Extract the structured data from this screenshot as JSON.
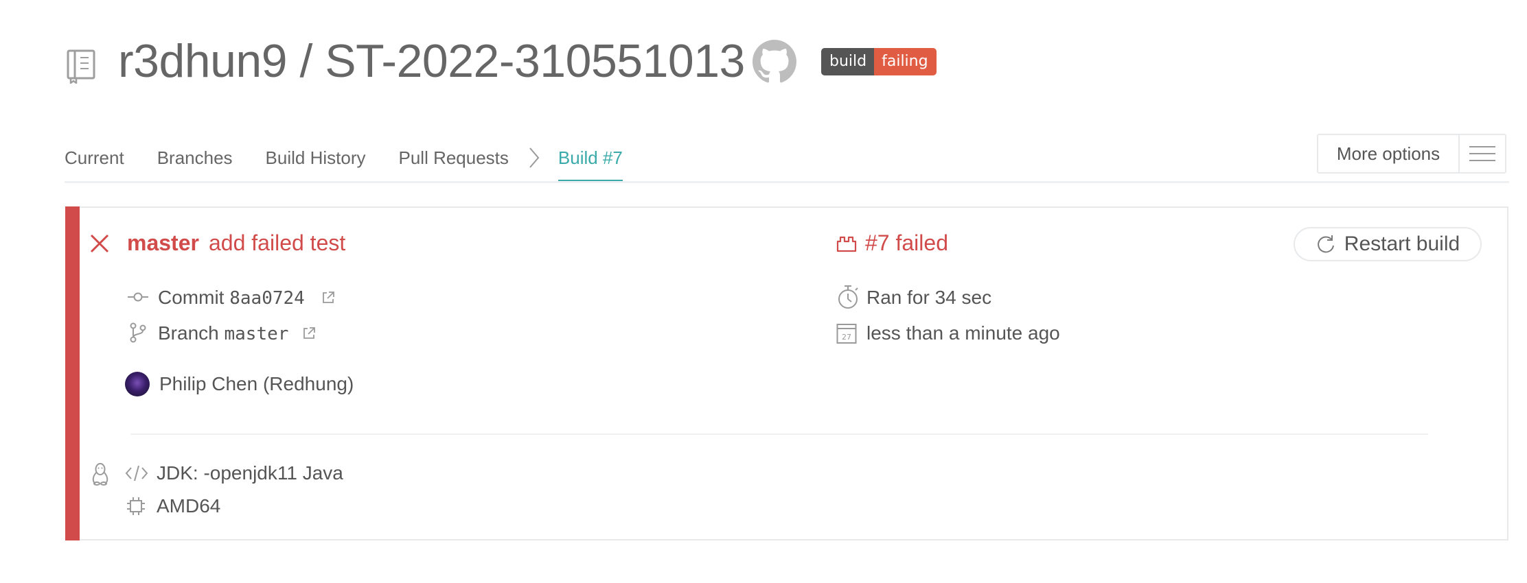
{
  "header": {
    "owner": "r3dhun9",
    "separator": "/",
    "repo": "ST-2022-310551013",
    "repo_icon": "repo-book-icon",
    "github_icon": "github-icon",
    "badge": {
      "left": "build",
      "right": "failing",
      "left_color": "#555555",
      "right_color": "#e05d44"
    }
  },
  "tabs": {
    "items": [
      "Current",
      "Branches",
      "Build History",
      "Pull Requests"
    ],
    "active": "Build #7",
    "active_color": "#39aaa9"
  },
  "more_options": {
    "label": "More options",
    "icon": "hamburger-icon"
  },
  "build": {
    "status": "failed",
    "status_color": "#d24b4b",
    "branch": "master",
    "message": "add failed test",
    "number_label": "#7 failed",
    "commit_label": "Commit",
    "commit_sha": "8aa0724",
    "branch_label": "Branch",
    "branch_value": "master",
    "author": "Philip Chen (Redhung)",
    "duration": "Ran for 34 sec",
    "finished": "less than a minute ago",
    "restart_label": "Restart build"
  },
  "job": {
    "os_icon": "linux-icon",
    "language": "JDK: -openjdk11 Java",
    "arch": "AMD64"
  }
}
